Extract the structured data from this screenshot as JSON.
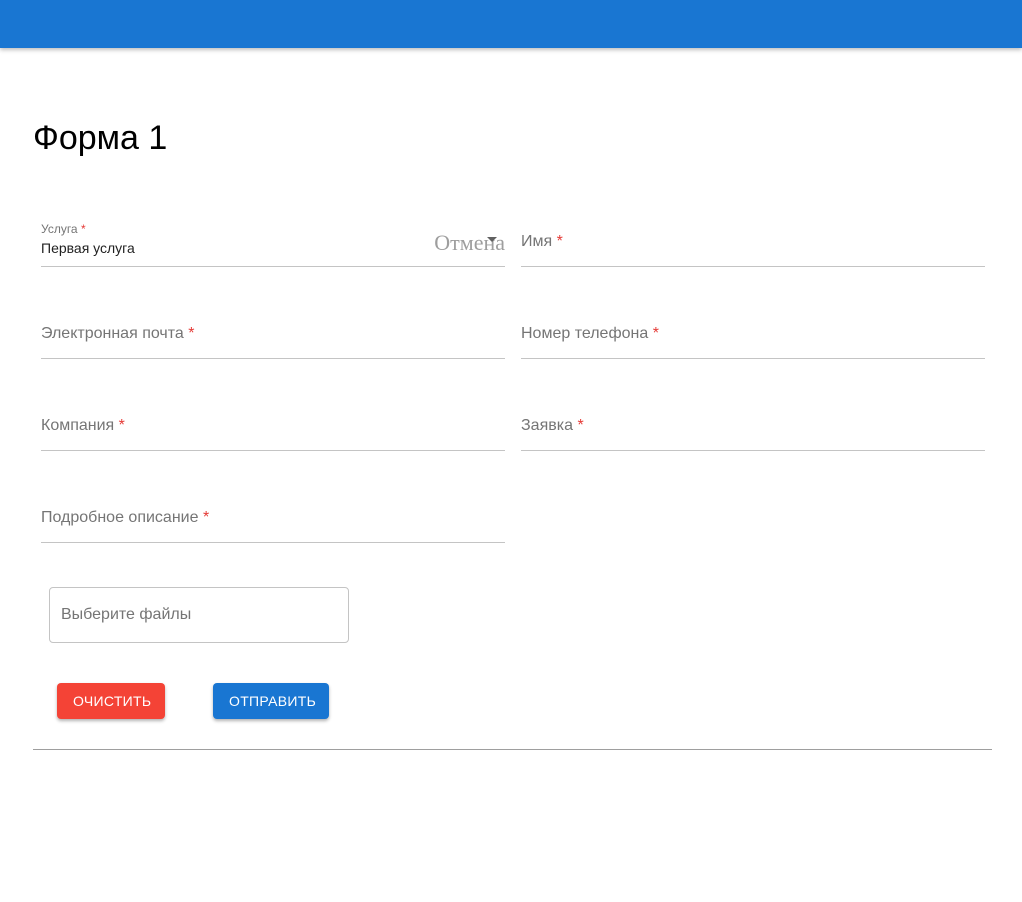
{
  "form": {
    "title": "Форма 1",
    "service": {
      "label": "Услуга",
      "required_mark": "*",
      "value": "Первая услуга",
      "cancel_text": "Отмена"
    },
    "name": {
      "label": "Имя",
      "required_mark": "*"
    },
    "email": {
      "label": "Электронная почта",
      "required_mark": "*"
    },
    "phone": {
      "label": "Номер телефона",
      "required_mark": "*"
    },
    "company": {
      "label": "Компания",
      "required_mark": "*"
    },
    "request": {
      "label": "Заявка",
      "required_mark": "*"
    },
    "description": {
      "label": "Подробное описание",
      "required_mark": "*"
    },
    "files": {
      "label": "Выберите файлы"
    },
    "buttons": {
      "clear": "ОЧИСТИТЬ",
      "submit": "ОТПРАВИТЬ"
    }
  },
  "colors": {
    "appbar": "#1976d2",
    "clear_button": "#f44336",
    "submit_button": "#1976d2",
    "required": "#e53935"
  }
}
